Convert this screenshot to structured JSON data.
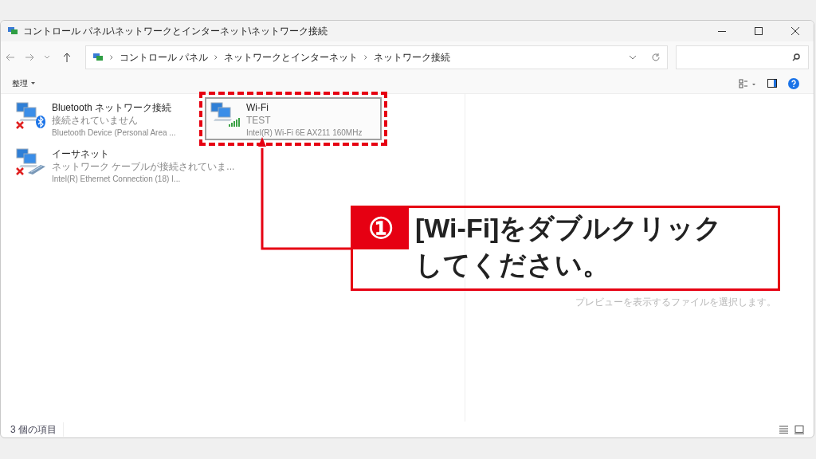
{
  "window": {
    "title": "コントロール パネル\\ネットワークとインターネット\\ネットワーク接続"
  },
  "address_bar": {
    "crumbs": [
      "コントロール パネル",
      "ネットワークとインターネット",
      "ネットワーク接続"
    ]
  },
  "toolbar": {
    "organize": "整理"
  },
  "connections": [
    {
      "kind": "bluetooth",
      "name": "Bluetooth ネットワーク接続",
      "status": "接続されていません",
      "device": "Bluetooth Device (Personal Area ...",
      "disconnected": true,
      "selected": false
    },
    {
      "kind": "wifi",
      "name": "Wi-Fi",
      "status": "TEST",
      "device": "Intel(R) Wi-Fi 6E AX211 160MHz",
      "disconnected": false,
      "selected": true
    },
    {
      "kind": "ethernet",
      "name": "イーサネット",
      "status": "ネットワーク ケーブルが接続されていま...",
      "device": "Intel(R) Ethernet Connection (18) I...",
      "disconnected": true,
      "selected": false
    }
  ],
  "preview_pane": {
    "message": "プレビューを表示するファイルを選択します。"
  },
  "status_bar": {
    "count": "3 個の項目"
  },
  "callout": {
    "number": "①",
    "lines": [
      "[Wi-Fi]をダブルクリック",
      "してください。"
    ]
  }
}
